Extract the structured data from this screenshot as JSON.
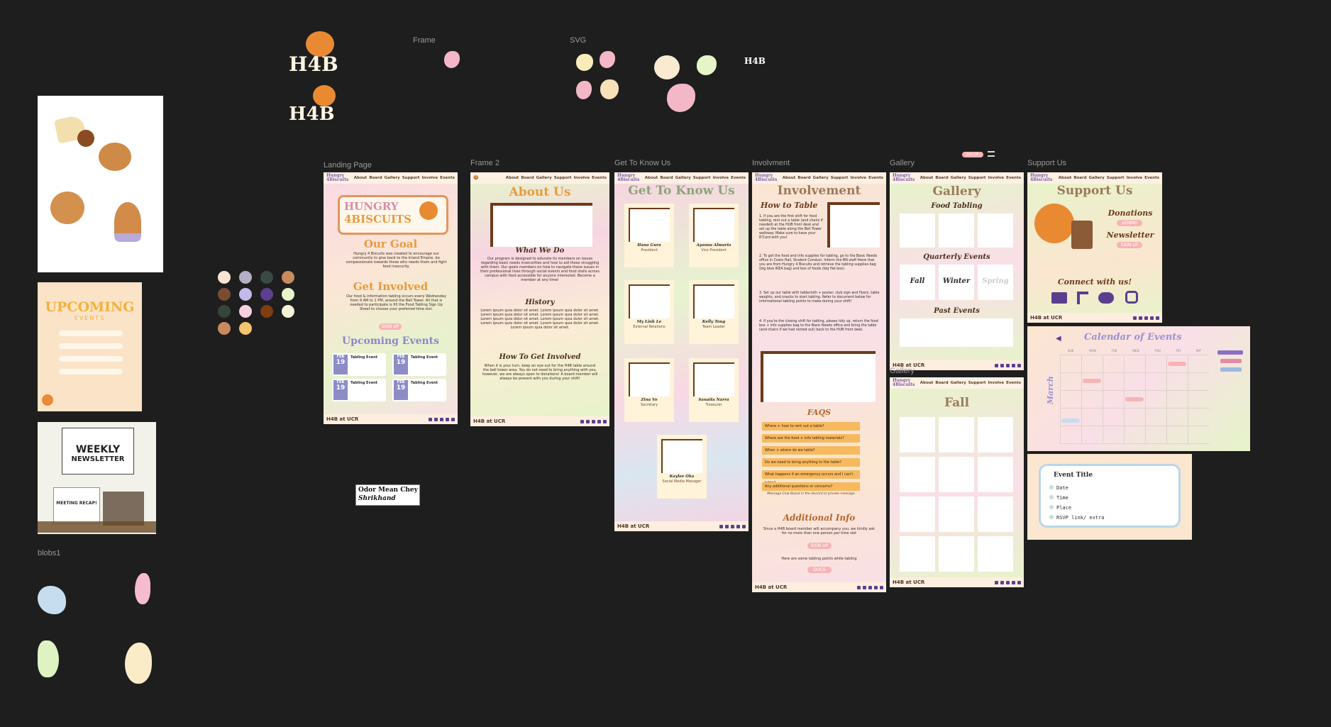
{
  "canvas": {
    "background": "#1e1e1e"
  },
  "labels": {
    "frame": "Frame",
    "svg": "SVG",
    "h4b_text": "H4B",
    "landing": "Landing Page",
    "frame2": "Frame 2",
    "gtku": "Get To Know Us",
    "involvement": "Involvment",
    "gallery": "Gallery",
    "gallery2": "Gallery",
    "support": "Support Us",
    "blobs": "blobs1",
    "join_pill": "Join Us"
  },
  "logo": {
    "text": "H4B"
  },
  "nav": {
    "logo_line1": "Hungry",
    "logo_line2": "4Biscuits",
    "links": [
      "About",
      "Board",
      "Gallery",
      "Support",
      "Involve",
      "Events"
    ]
  },
  "footer": {
    "text": "H4B at UCR"
  },
  "font_sample": {
    "line1": "Odor Mean Chey",
    "line2": "Shrikhand"
  },
  "palette": [
    "#f8e6d3",
    "#b6aec6",
    "#3b4a44",
    "#c98b5e",
    "#7a4b33",
    "#c5b8ea",
    "#5c3f8f",
    "#e8f4c9",
    "#37443b",
    "#f6cfe0",
    "#7c3f12",
    "#f5f2d6",
    "#c98b5e",
    "#f4c46e"
  ],
  "landing": {
    "hero_line1": "HUNGRY",
    "hero_line2": "4BISCUITS",
    "goal_title": "Our Goal",
    "goal_text": "Hungry 4 Biscuits was created to encourage our community to give back to the Inland Empire, be compassionate towards those who needs them and fight food insecurity.",
    "involved_title": "Get Involved",
    "involved_text": "Our food & information tabling occurs every Wednesday from 9 AM to 1 PM, around the Bell Tower. All that is needed to participate is fill the Food Tabling Sign Up Sheet to choose your preferred time slot.",
    "signup": "SIGN UP",
    "events_title": "Upcoming Events",
    "events": [
      {
        "month": "FEB",
        "day": "19",
        "title": "Tabling Event"
      },
      {
        "month": "FEB",
        "day": "19",
        "title": "Tabling Event"
      },
      {
        "month": "FEB",
        "day": "19",
        "title": "Tabling Event"
      },
      {
        "month": "FEB",
        "day": "19",
        "title": "Tabling Event"
      }
    ]
  },
  "about": {
    "title": "About Us",
    "what_title": "What We Do",
    "what_text": "Our program is designed to educate its members on issues regarding basic needs insecurities and how to aid those struggling with them. Our goals members on how to navigate these issues in their professional lives through social events and food stalls across campus with food accessible for anyone interested. Become a member at any time!",
    "history_title": "History",
    "history_text": "Lorem ipsum quia dolor sit amet. Lorem ipsum quia dolor sit amet. Lorem ipsum quia dolor sit amet. Lorem ipsum quia dolor sit amet. Lorem ipsum quia dolor sit amet. Lorem ipsum quia dolor sit amet. Lorem ipsum quia dolor sit amet. Lorem ipsum quia dolor sit amet. Lorem ipsum quia dolor sit amet.",
    "how_title": "How To Get Involved",
    "how_text": "When it is your turn, keep an eye out for the H4B table around the bell tower area. You do not need to bring anything with you, however, we are always open to donations! A board member will always be present with you during your shift!"
  },
  "gtku": {
    "title": "Get To Know Us",
    "members": [
      {
        "name": "Hana Gura",
        "role": "President"
      },
      {
        "name": "Ayanna Almario",
        "role": "Vice President"
      },
      {
        "name": "My Linh Le",
        "role": "External Relations"
      },
      {
        "name": "Kelly Tong",
        "role": "Team Leader"
      },
      {
        "name": "Zina Vo",
        "role": "Secretary"
      },
      {
        "name": "Sanaita Narra",
        "role": "Treasurer"
      },
      {
        "name": "Kaylee Oka",
        "role": "Social Media Manager"
      }
    ]
  },
  "involvement": {
    "title": "Involvement",
    "how_title": "How to Table",
    "steps": [
      "1. If you are the first shift for food tabling, rent out a table (and chairs if needed) at the HUB front desk and set up the table along the Bell Tower walkway. Make sure to have your R'Card with you!",
      "2. To get the food and info supplies for tabling, go to the Basic Needs office in Costo Hall, Student Conduct. Inform the BN staff there that you are from Hungry 4 Biscuits and retrieve the tabling supplies bag (big blue IKEA bag) and box of foods (big flat box).",
      "3. Set up our table with tablecloth + poster, club sign and flyers, table weights, and snacks to start tabling. Refer to document below for informational tabling points to make during your shift!",
      "4. If you're the closing shift for tabling, please tidy up, return the food box + info supplies bag to the Basic Needs office and bring the table (and chairs if we had rented out) back to the HUB front desk."
    ],
    "faq_title": "FAQS",
    "faqs": [
      "Where + how to rent out a table?",
      "Where are the food + info tabling materials?",
      "When + where do we table?",
      "Do we need to bring anything to the table?",
      "What happens if an emergency occurs and I can't table?",
      "Any additional questions or concerns?"
    ],
    "faq_note": "Message Club Board in the discord or private message",
    "add_title": "Additional Info",
    "add_text": "Since a H4B board member will accompany you, we kindly ask for no more than one person per time slot",
    "signup": "SIGN UP",
    "add_text2": "Here are some tabling points while tabling",
    "docs": "DOCS"
  },
  "gallery": {
    "title": "Gallery",
    "food": "Food Tabling",
    "quarterly": "Quarterly Events",
    "seasons": [
      "Fall",
      "Winter",
      "Spring"
    ],
    "past": "Past Events",
    "fall_title": "Fall"
  },
  "support": {
    "title": "Support Us",
    "donations": "Donations",
    "venmo": "VENMO",
    "newsletter": "Newsletter",
    "signup": "SIGN UP",
    "connect": "Connect with us!",
    "social_icons": [
      "mail-icon",
      "tiktok-icon",
      "discord-icon",
      "instagram-icon"
    ]
  },
  "calendar": {
    "title": "Calendar of Events",
    "month": "March",
    "days": [
      "SUN",
      "MON",
      "TUE",
      "WED",
      "THU",
      "FRI",
      "SAT"
    ]
  },
  "event_card": {
    "title": "Event Title",
    "fields": [
      "Date",
      "Time",
      "Place",
      "RSVP link/ extra"
    ]
  },
  "upcoming_thumb": {
    "title": "UPCOMING",
    "subtitle": "EVENTS"
  },
  "newsletter_thumb": {
    "title": "WEEKLY",
    "subtitle": "NEWSLETTER",
    "recap": "MEETING RECAP!"
  }
}
